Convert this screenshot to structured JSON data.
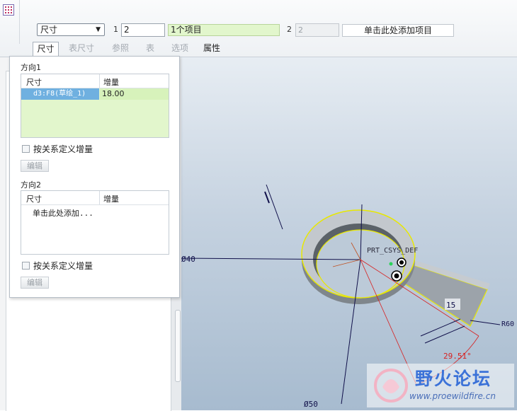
{
  "ribbon": {
    "dim_type": "尺寸",
    "dir1_num": "1",
    "dir1_count": "2",
    "dir1_collector": "1个项目",
    "dir2_num": "2",
    "dir2_count": "2",
    "dir2_collector": "单击此处添加项目"
  },
  "tabs": [
    "尺寸",
    "表尺寸",
    "参照",
    "表",
    "选项",
    "属性"
  ],
  "panel": {
    "dir1_title": "方向1",
    "dir2_title": "方向2",
    "col_dim": "尺寸",
    "col_incr": "增量",
    "row_dim": "d3:F8(草绘_1)",
    "row_incr": "18.00",
    "dir2_placeholder": "单击此处添加...",
    "relation_label": "按关系定义增量",
    "edit_label": "编辑"
  },
  "viewport": {
    "csys_label": "PRT_CSYS_DEF",
    "dim_diameter_40": "Ø40",
    "dim_diameter_50": "Ø50",
    "dim_15": "15",
    "dim_r60": "R60",
    "dim_angle": "29.51°"
  },
  "watermark": {
    "title": "野火论坛",
    "url": "www.proewildfire.cn"
  },
  "colors": {
    "accent_blue": "#6fb0e0",
    "collector_green": "#e2f6cc",
    "highlight_yellow": "#e8e800",
    "angle_red": "#d82020"
  }
}
